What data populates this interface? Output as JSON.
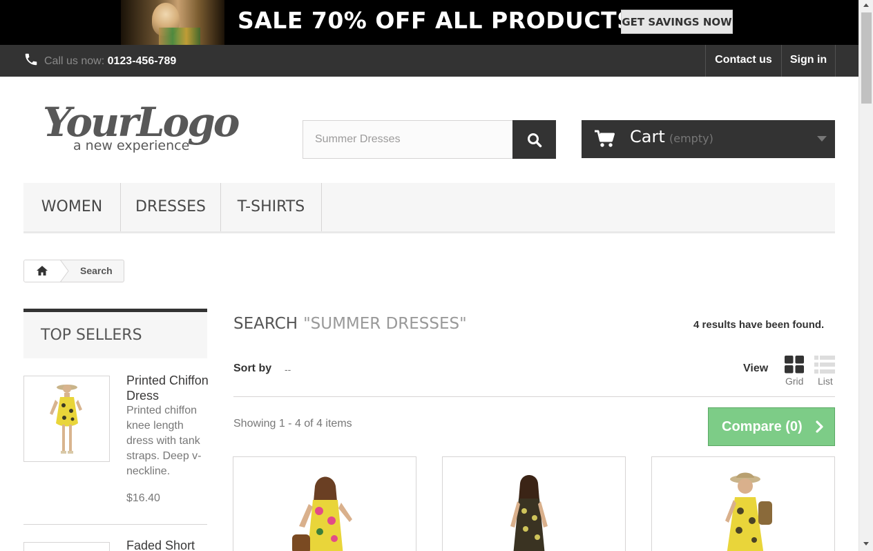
{
  "banner": {
    "sale_text": "SALE 70% OFF ALL PRODUCTS",
    "cta_label": "GET SAVINGS NOW"
  },
  "nav": {
    "call_label": "Call us now:",
    "phone": "0123-456-789",
    "contact_label": "Contact us",
    "signin_label": "Sign in"
  },
  "header": {
    "logo_main": "YourLogo",
    "logo_tagline": "a new experience",
    "search_value": "Summer Dresses",
    "cart_label": "Cart",
    "cart_status": "(empty)"
  },
  "menu": {
    "items": [
      {
        "label": "WOMEN"
      },
      {
        "label": "DRESSES"
      },
      {
        "label": "T-SHIRTS"
      }
    ]
  },
  "breadcrumb": {
    "current": "Search"
  },
  "sidebar": {
    "title": "TOP SELLERS",
    "products": [
      {
        "name": "Printed Chiffon Dress",
        "description": "Printed chiffon knee length dress with tank straps. Deep v-neckline.",
        "price": "$16.40"
      },
      {
        "name": "Faded Short"
      }
    ]
  },
  "main": {
    "title": "SEARCH",
    "query": "\"SUMMER DRESSES\"",
    "results_text": "4 results have been found.",
    "sort_label": "Sort by",
    "sort_value": "--",
    "view_label": "View",
    "grid_label": "Grid",
    "list_label": "List",
    "showing_text": "Showing 1 - 4 of 4 items",
    "compare_label": "Compare (0)"
  },
  "colors": {
    "dark_bar": "#333333",
    "compare_green": "#7dcc87",
    "menu_bg": "#f6f6f6"
  },
  "icons": {
    "phone": "phone-icon",
    "search": "search-icon",
    "cart": "cart-icon",
    "home": "home-icon",
    "grid": "grid-view-icon",
    "list": "list-view-icon",
    "compare": "chevron-right-icon"
  }
}
